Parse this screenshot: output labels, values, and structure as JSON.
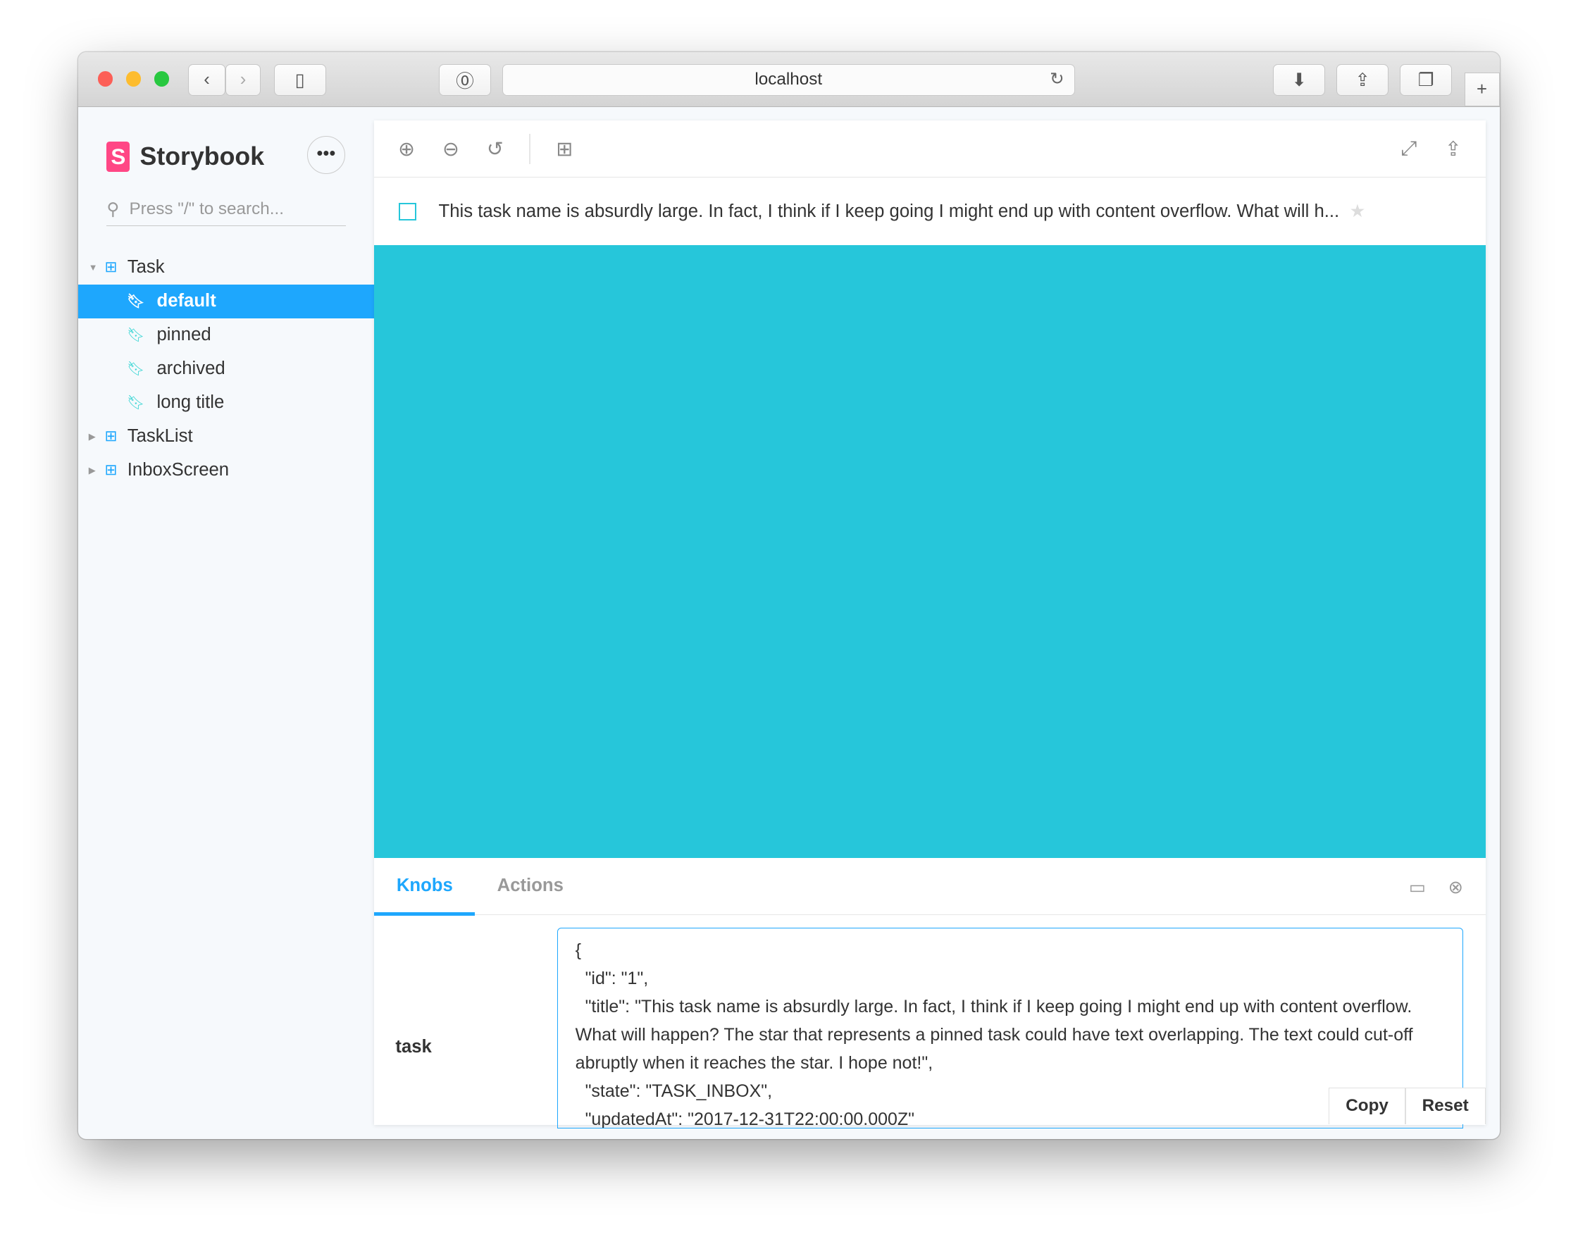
{
  "browser": {
    "url": "localhost"
  },
  "sidebar": {
    "brand": "Storybook",
    "search_placeholder": "Press \"/\" to search...",
    "tree": [
      {
        "label": "Task",
        "type": "component",
        "expanded": true
      },
      {
        "label": "default",
        "type": "story",
        "selected": true
      },
      {
        "label": "pinned",
        "type": "story"
      },
      {
        "label": "archived",
        "type": "story"
      },
      {
        "label": "long title",
        "type": "story"
      },
      {
        "label": "TaskList",
        "type": "component",
        "expanded": false
      },
      {
        "label": "InboxScreen",
        "type": "component",
        "expanded": false
      }
    ]
  },
  "preview": {
    "task_title": "This task name is absurdly large. In fact, I think if I keep going I might end up with content overflow. What will h...",
    "canvas_color": "#26c6da"
  },
  "addons": {
    "tabs": [
      "Knobs",
      "Actions"
    ],
    "active_tab": "Knobs",
    "knob_name": "task",
    "knob_value": "{\n  \"id\": \"1\",\n  \"title\": \"This task name is absurdly large. In fact, I think if I keep going I might end up with content overflow. What will happen? The star that represents a pinned task could have text overlapping. The text could cut-off abruptly when it reaches the star. I hope not!\",\n  \"state\": \"TASK_INBOX\",\n  \"updatedAt\": \"2017-12-31T22:00:00.000Z\"",
    "copy_label": "Copy",
    "reset_label": "Reset"
  },
  "colors": {
    "accent": "#1ea7fd",
    "brand": "#ff4785"
  }
}
